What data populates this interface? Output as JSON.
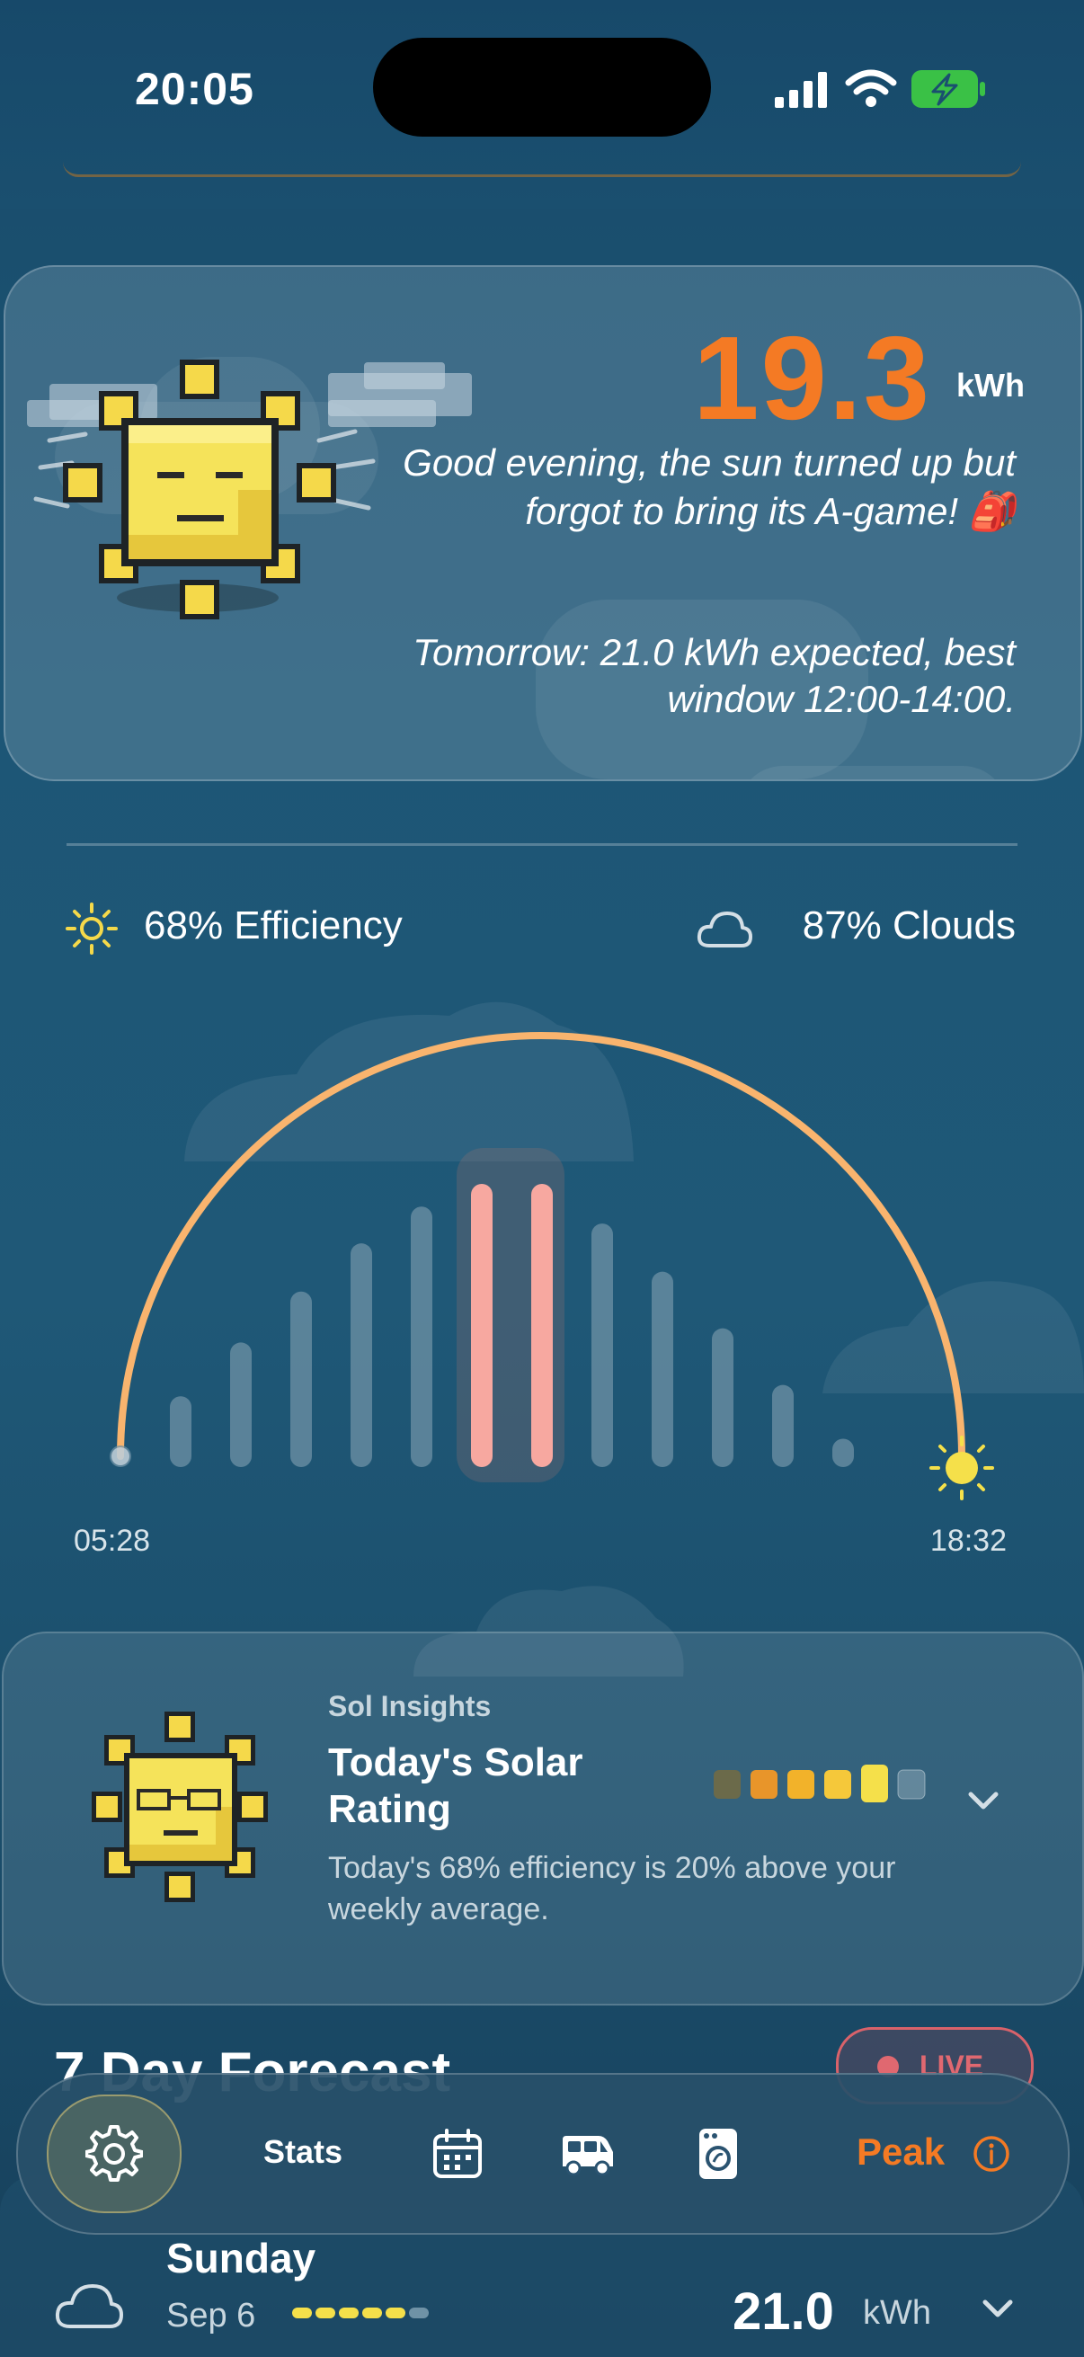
{
  "status_bar": {
    "time": "20:05"
  },
  "hero": {
    "energy_value": "19.3",
    "energy_unit": "kWh",
    "greeting": "Good evening, the sun turned up but forgot to bring its A-game! 🎒",
    "tomorrow": "Tomorrow: 21.0 kWh expected, best window 12:00-14:00."
  },
  "stats": {
    "efficiency": "68% Efficiency",
    "clouds": "87% Clouds"
  },
  "chart_data": {
    "type": "bar",
    "sunrise": "05:28",
    "sunset": "18:32",
    "relative_production": [
      0.05,
      0.25,
      0.44,
      0.62,
      0.79,
      0.92,
      1.0,
      1.0,
      0.86,
      0.69,
      0.49,
      0.29,
      0.1
    ],
    "highlighted_bars": [
      6,
      7
    ],
    "colors": {
      "arc": "#f9b46e",
      "bar": "#6f92a6",
      "highlight": "#f7a8a0",
      "sun": "#f5e04a"
    }
  },
  "insights": {
    "kicker": "Sol Insights",
    "title": "Today's Solar Rating",
    "description": "Today's 68% efficiency is 20% above your weekly average.",
    "rating": 5,
    "rating_max": 6
  },
  "forecast": {
    "title": "7 Day Forecast",
    "live_label": "LIVE",
    "day": "Sunday",
    "date": "Sep 6",
    "value": "21.0",
    "unit": "kWh"
  },
  "tab_bar": {
    "stats_label": "Stats",
    "peak_label": "Peak"
  }
}
